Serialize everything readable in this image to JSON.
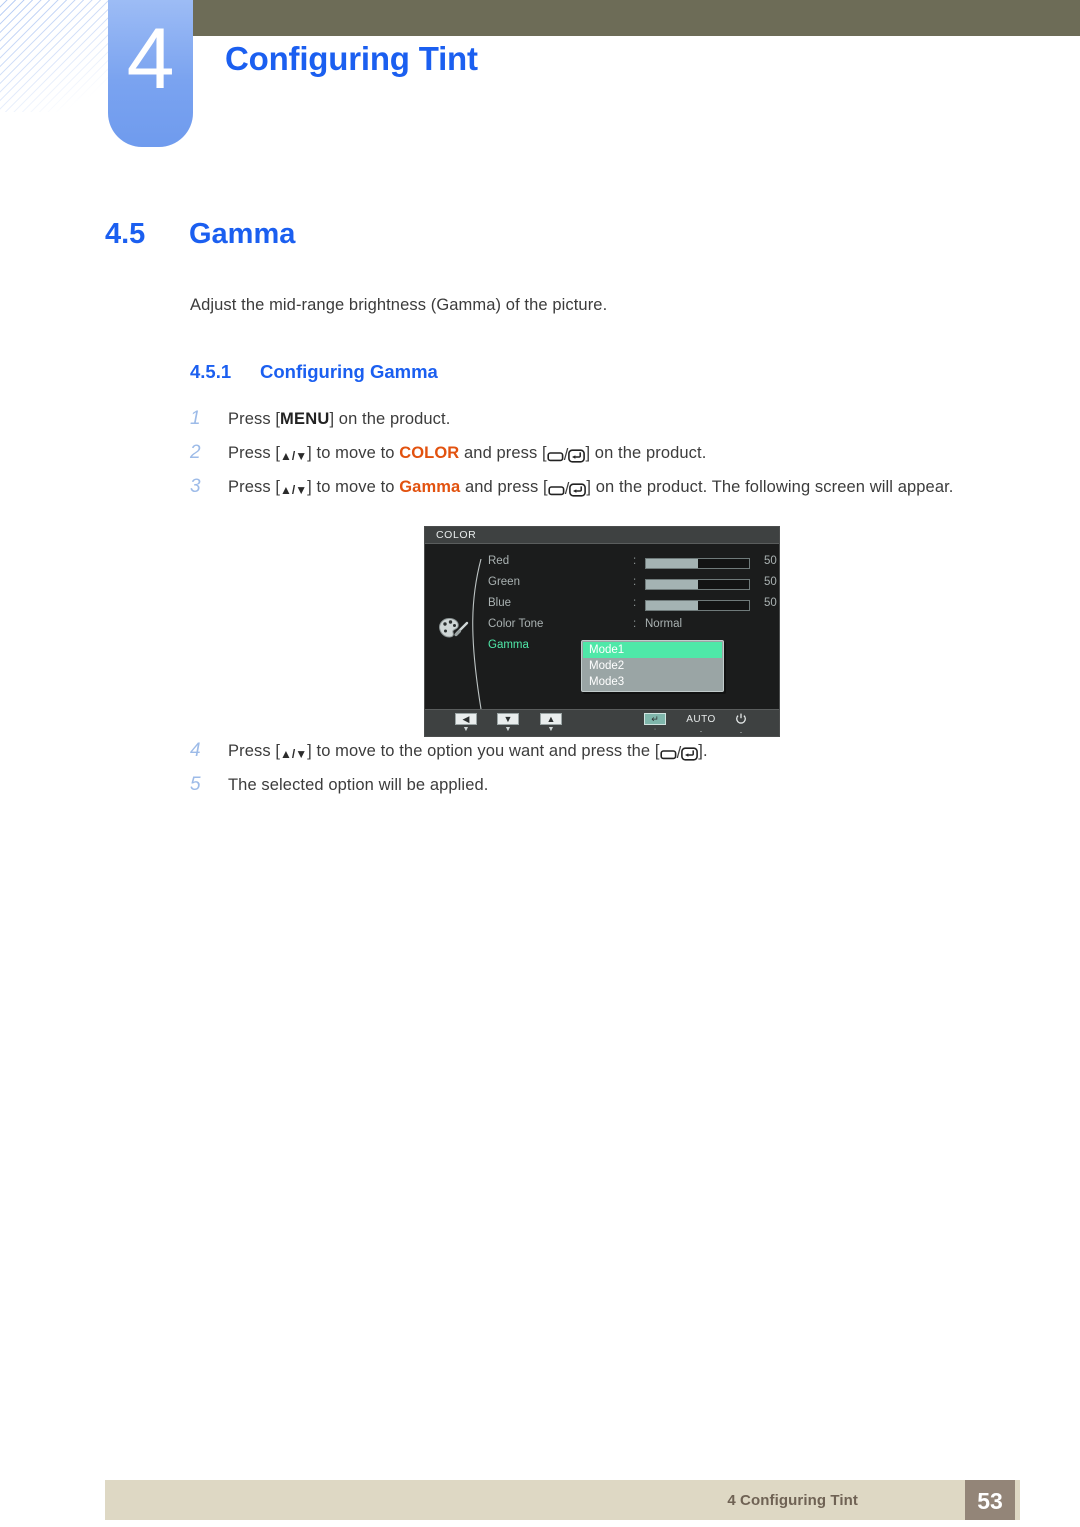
{
  "header": {
    "chapter_number": "4",
    "chapter_title": "Configuring Tint"
  },
  "section": {
    "number": "4.5",
    "title": "Gamma",
    "intro": "Adjust the mid-range brightness (Gamma) of the picture."
  },
  "subsection": {
    "number": "4.5.1",
    "title": "Configuring Gamma"
  },
  "steps_before": [
    {
      "num": "1",
      "parts": [
        {
          "t": "Press [",
          "style": "plain"
        },
        {
          "t": "MENU",
          "style": "menu"
        },
        {
          "t": "] on the product.",
          "style": "plain"
        }
      ]
    },
    {
      "num": "2",
      "parts": [
        {
          "t": "Press [",
          "style": "plain"
        },
        {
          "t": "arrows",
          "style": "glyph-arrows"
        },
        {
          "t": "] to move to ",
          "style": "plain"
        },
        {
          "t": "COLOR",
          "style": "orange"
        },
        {
          "t": " and press [",
          "style": "plain"
        },
        {
          "t": "keys",
          "style": "glyph-keys"
        },
        {
          "t": "] on the product.",
          "style": "plain"
        }
      ]
    },
    {
      "num": "3",
      "parts": [
        {
          "t": "Press [",
          "style": "plain"
        },
        {
          "t": "arrows",
          "style": "glyph-arrows"
        },
        {
          "t": "] to move to ",
          "style": "plain"
        },
        {
          "t": "Gamma",
          "style": "orange"
        },
        {
          "t": " and press [",
          "style": "plain"
        },
        {
          "t": "keys",
          "style": "glyph-keys"
        },
        {
          "t": "] on the product. The following screen will appear.",
          "style": "plain"
        }
      ]
    }
  ],
  "steps_after": [
    {
      "num": "4",
      "parts": [
        {
          "t": "Press [",
          "style": "plain"
        },
        {
          "t": "arrows",
          "style": "glyph-arrows"
        },
        {
          "t": "] to move to the option you want and press the [",
          "style": "plain"
        },
        {
          "t": "keys",
          "style": "glyph-keys"
        },
        {
          "t": "].",
          "style": "plain"
        }
      ]
    },
    {
      "num": "5",
      "parts": [
        {
          "t": "The selected option will be applied.",
          "style": "plain"
        }
      ]
    }
  ],
  "osd": {
    "title": "COLOR",
    "menu_icon": "color-palette-icon",
    "rows": [
      {
        "label": "Red",
        "type": "slider",
        "value": "50",
        "fill_pct": 50
      },
      {
        "label": "Green",
        "type": "slider",
        "value": "50",
        "fill_pct": 50
      },
      {
        "label": "Blue",
        "type": "slider",
        "value": "50",
        "fill_pct": 50
      },
      {
        "label": "Color Tone",
        "type": "text",
        "value": "Normal"
      },
      {
        "label": "Gamma",
        "type": "dropdown",
        "selected": true
      }
    ],
    "dropdown_options": [
      {
        "label": "Mode1",
        "active": true
      },
      {
        "label": "Mode2",
        "active": false
      },
      {
        "label": "Mode3",
        "active": false
      }
    ],
    "toolbar": [
      {
        "name": "back-button",
        "glyph": "◀",
        "sub": "▼",
        "kind": "box"
      },
      {
        "name": "down-button",
        "glyph": "▼",
        "sub": "▼",
        "kind": "box"
      },
      {
        "name": "up-button",
        "glyph": "▲",
        "sub": "▼",
        "kind": "box"
      },
      {
        "name": "enter-button",
        "glyph": "↵",
        "sub": "·",
        "kind": "box-teal"
      },
      {
        "name": "auto-button",
        "glyph": "AUTO",
        "sub": "·",
        "kind": "text"
      },
      {
        "name": "power-button",
        "glyph": "⏻",
        "sub": "·",
        "kind": "icon"
      }
    ],
    "colors": {
      "highlight": "#4fe8a8",
      "panel": "#1b1c1c",
      "titlebar": "#3e4141",
      "slider_fill": "#a4b3b3"
    }
  },
  "footer": {
    "text": "4 Configuring Tint",
    "page_number": "53"
  },
  "theme": {
    "heading_blue": "#1b5ff0",
    "tab_blue": "#7aa3f0",
    "olive": "#6d6c57",
    "keyword_orange": "#e2520f",
    "step_number_blue": "#9dbbe8",
    "footer_beige": "#ded8c4",
    "footer_page_box": "#938578"
  }
}
